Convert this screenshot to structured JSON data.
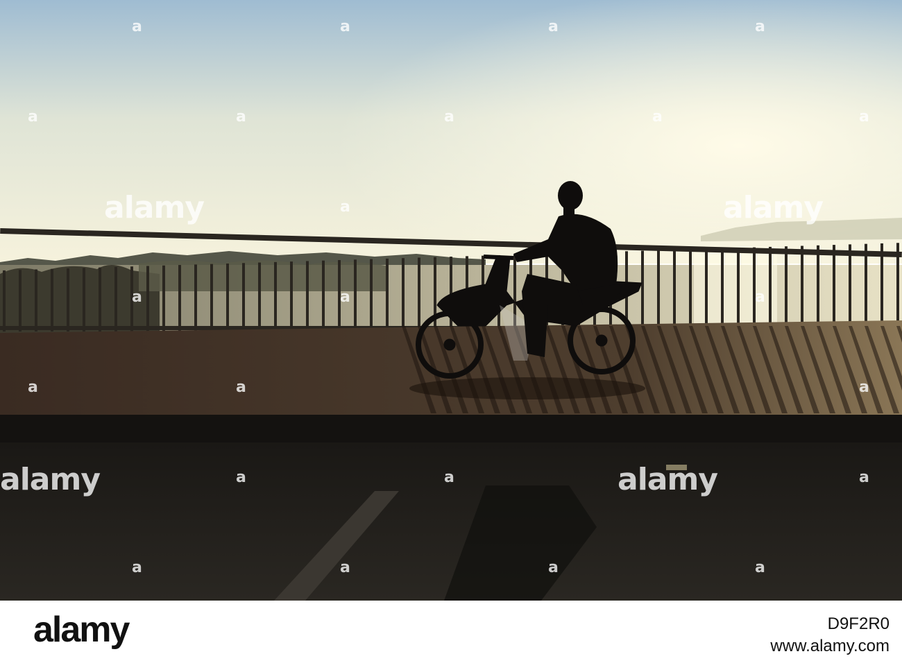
{
  "scene": {
    "subject": "silhouette-motorcyclist-on-bridge",
    "colors": {
      "sky_top": "#a9c4d9",
      "sky_bottom": "#f4f0d8",
      "water": "#c9c4a8",
      "railing": "#2a2620",
      "road": "#1f1c18",
      "glow": "#fff6d9"
    }
  },
  "watermarks": {
    "text": "alamy",
    "mark": "a"
  },
  "footer": {
    "logo": "alamy",
    "image_id": "D9F2R0",
    "site": "www.alamy.com"
  }
}
